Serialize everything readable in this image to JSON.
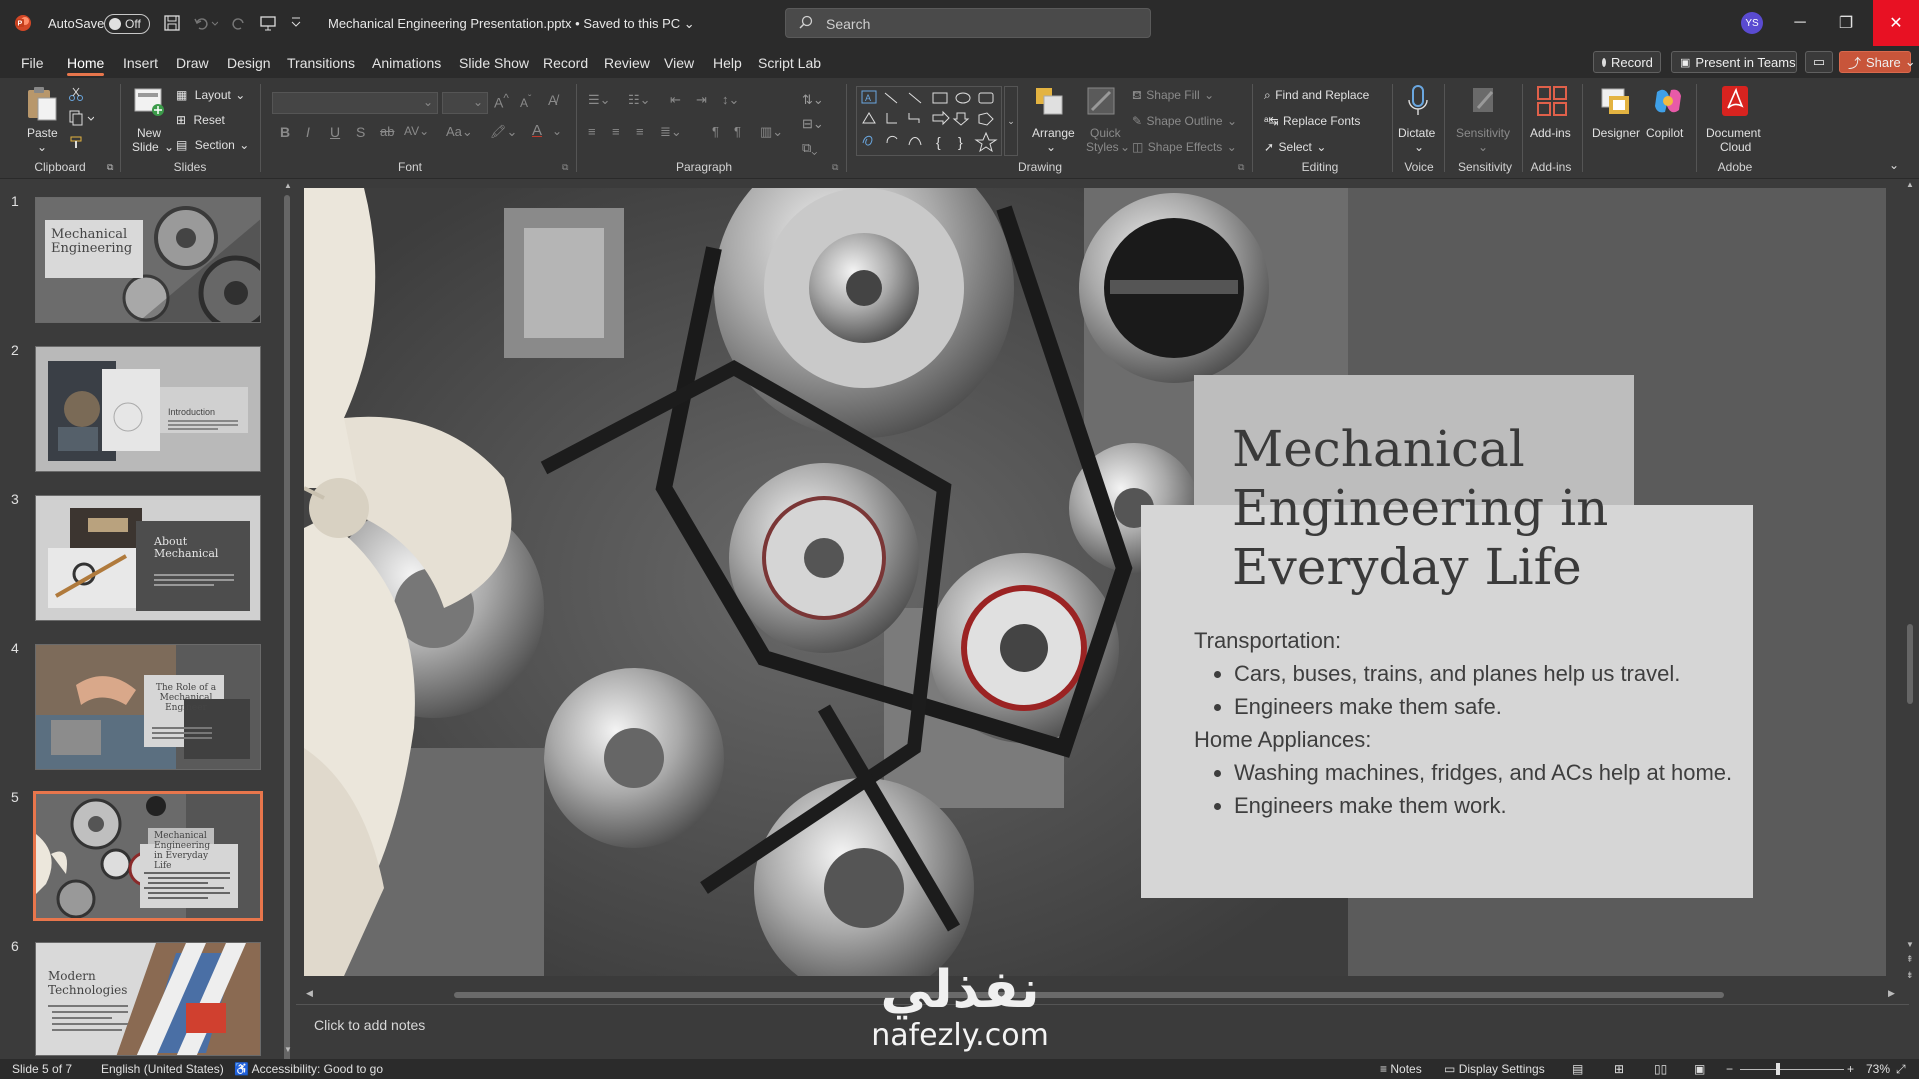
{
  "titlebar": {
    "autosave_label": "AutoSave",
    "autosave_state": "Off",
    "doc_title": "Mechanical Engineering Presentation.pptx",
    "save_status": "Saved to this PC",
    "search_placeholder": "Search",
    "user_initials": "YS"
  },
  "menu": {
    "items": [
      "File",
      "Home",
      "Insert",
      "Draw",
      "Design",
      "Transitions",
      "Animations",
      "Slide Show",
      "Record",
      "Review",
      "View",
      "Help",
      "Script Lab"
    ],
    "active": "Home",
    "record_btn": "Record",
    "present_btn": "Present in Teams",
    "share_btn": "Share"
  },
  "ribbon": {
    "clipboard": {
      "paste": "Paste",
      "label": "Clipboard"
    },
    "slides": {
      "new_slide_1": "New",
      "new_slide_2": "Slide",
      "layout": "Layout",
      "reset": "Reset",
      "section": "Section",
      "label": "Slides"
    },
    "font": {
      "label": "Font"
    },
    "paragraph": {
      "label": "Paragraph"
    },
    "drawing": {
      "arrange": "Arrange",
      "quick_styles_1": "Quick",
      "quick_styles_2": "Styles",
      "shape_fill": "Shape Fill",
      "shape_outline": "Shape Outline",
      "shape_effects": "Shape Effects",
      "label": "Drawing"
    },
    "editing": {
      "find_replace": "Find and Replace",
      "replace_fonts": "Replace Fonts",
      "select": "Select",
      "label": "Editing"
    },
    "voice": {
      "dictate": "Dictate",
      "label": "Voice"
    },
    "sensitivity": {
      "btn": "Sensitivity",
      "label": "Sensitivity"
    },
    "addins": {
      "btn": "Add-ins",
      "label": "Add-ins"
    },
    "designer": "Designer",
    "copilot": "Copilot",
    "adobe": {
      "doc_cloud_1": "Document",
      "doc_cloud_2": "Cloud",
      "label": "Adobe"
    }
  },
  "thumbnails": [
    {
      "num": "1",
      "title": "Mechanical Engineering"
    },
    {
      "num": "2",
      "title": "Introduction"
    },
    {
      "num": "3",
      "title": "About Mechanical"
    },
    {
      "num": "4",
      "title": "The Role of a Mechanical Engineer"
    },
    {
      "num": "5",
      "title": "Mechanical Engineering in Everyday Life",
      "selected": true
    },
    {
      "num": "6",
      "title": "Modern Technologies"
    }
  ],
  "slide": {
    "title": "Mechanical Engineering in Everyday Life",
    "heading1": "Transportation:",
    "bullet1": "Cars, buses, trains, and planes help us travel.",
    "bullet2": "Engineers make them safe.",
    "heading2": "Home Appliances:",
    "bullet3": "Washing machines, fridges, and ACs help at home.",
    "bullet4": "Engineers make them work."
  },
  "notes_placeholder": "Click to add notes",
  "watermark": {
    "arabic": "نفذلي",
    "latin": "nafezly.com"
  },
  "statusbar": {
    "slide_count": "Slide 5 of 7",
    "language": "English (United States)",
    "accessibility": "Accessibility: Good to go",
    "notes": "Notes",
    "display_settings": "Display Settings",
    "zoom": "73%"
  },
  "colors": {
    "accent": "#e8764c",
    "close_red": "#e81123",
    "avatar": "#5a4bd1"
  }
}
